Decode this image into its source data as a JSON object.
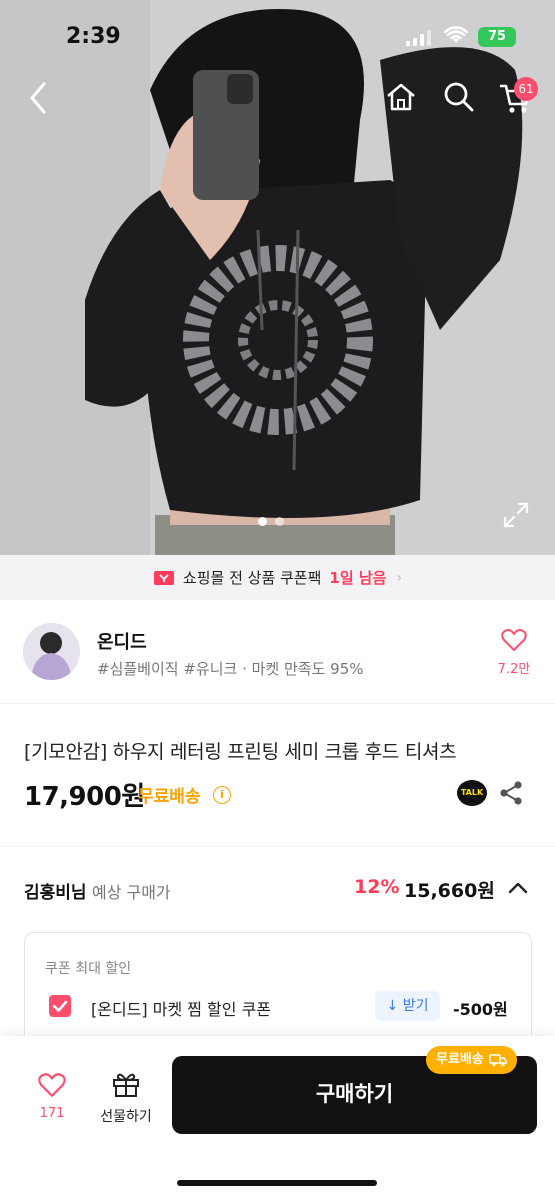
{
  "status": {
    "time": "2:39",
    "battery": "75"
  },
  "nav": {
    "cart_count": "61"
  },
  "coupon_banner": {
    "text": "쇼핑몰 전 상품 쿠폰팩",
    "highlight": "1일 남음",
    "arrow": "›"
  },
  "shop": {
    "name": "온디드",
    "tags": "#심플베이직 #유니크 · 마켓 만족도 95%",
    "likes": "7.2만"
  },
  "product": {
    "title": "[기모안감] 하우지 레터링 프린팅 세미 크롭 후드 티셔츠",
    "price": "17,900원",
    "shipping": "무료배송",
    "talk_label": "TALK"
  },
  "member_price": {
    "name": "김홍비님",
    "label": "예상 구매가",
    "rate": "12%",
    "price": "15,660원"
  },
  "coupon": {
    "section_title": "쿠폰 최대 할인",
    "label": "[온디드] 마켓 찜 할인 쿠폰",
    "get_label": "↓ 받기",
    "amount": "-500원"
  },
  "bottom_bar": {
    "wish_count": "171",
    "gift_label": "선물하기",
    "buy_label": "구매하기",
    "ship_chip": "무료배송"
  },
  "colors": {
    "accent": "#ff4d6d",
    "shipping": "#ffa200",
    "primary_button": "#111111"
  }
}
